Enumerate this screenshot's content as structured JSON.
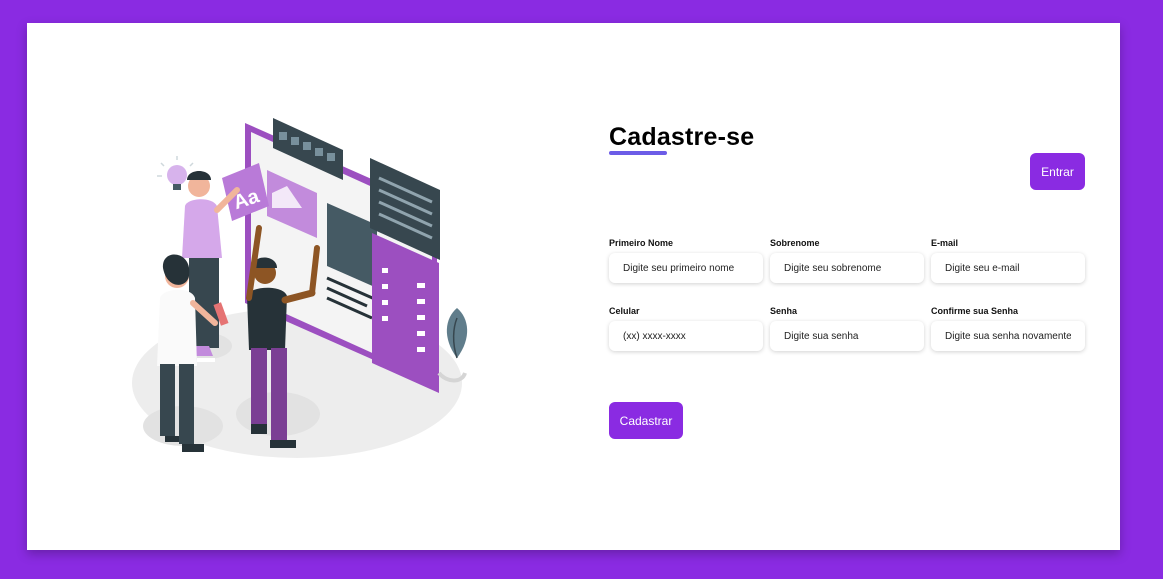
{
  "page": {
    "title": "Cadastre-se",
    "login_label": "Entrar",
    "submit_label": "Cadastrar"
  },
  "form": {
    "fields": [
      {
        "label": "Primeiro Nome",
        "placeholder": "Digite seu primeiro nome"
      },
      {
        "label": "Sobrenome",
        "placeholder": "Digite seu sobrenome"
      },
      {
        "label": "E-mail",
        "placeholder": "Digite seu e-mail"
      },
      {
        "label": "Celular",
        "placeholder": "(xx) xxxx-xxxx"
      },
      {
        "label": "Senha",
        "placeholder": "Digite sua senha"
      },
      {
        "label": "Confirme sua Senha",
        "placeholder": "Digite sua senha novamente"
      }
    ]
  },
  "illustration": {
    "letters": "Aa",
    "description_icon": "web-design-team-illustration"
  },
  "colors": {
    "background": "#8a2be2",
    "accent": "#8a2be2",
    "underline": "#6c5ce7"
  }
}
